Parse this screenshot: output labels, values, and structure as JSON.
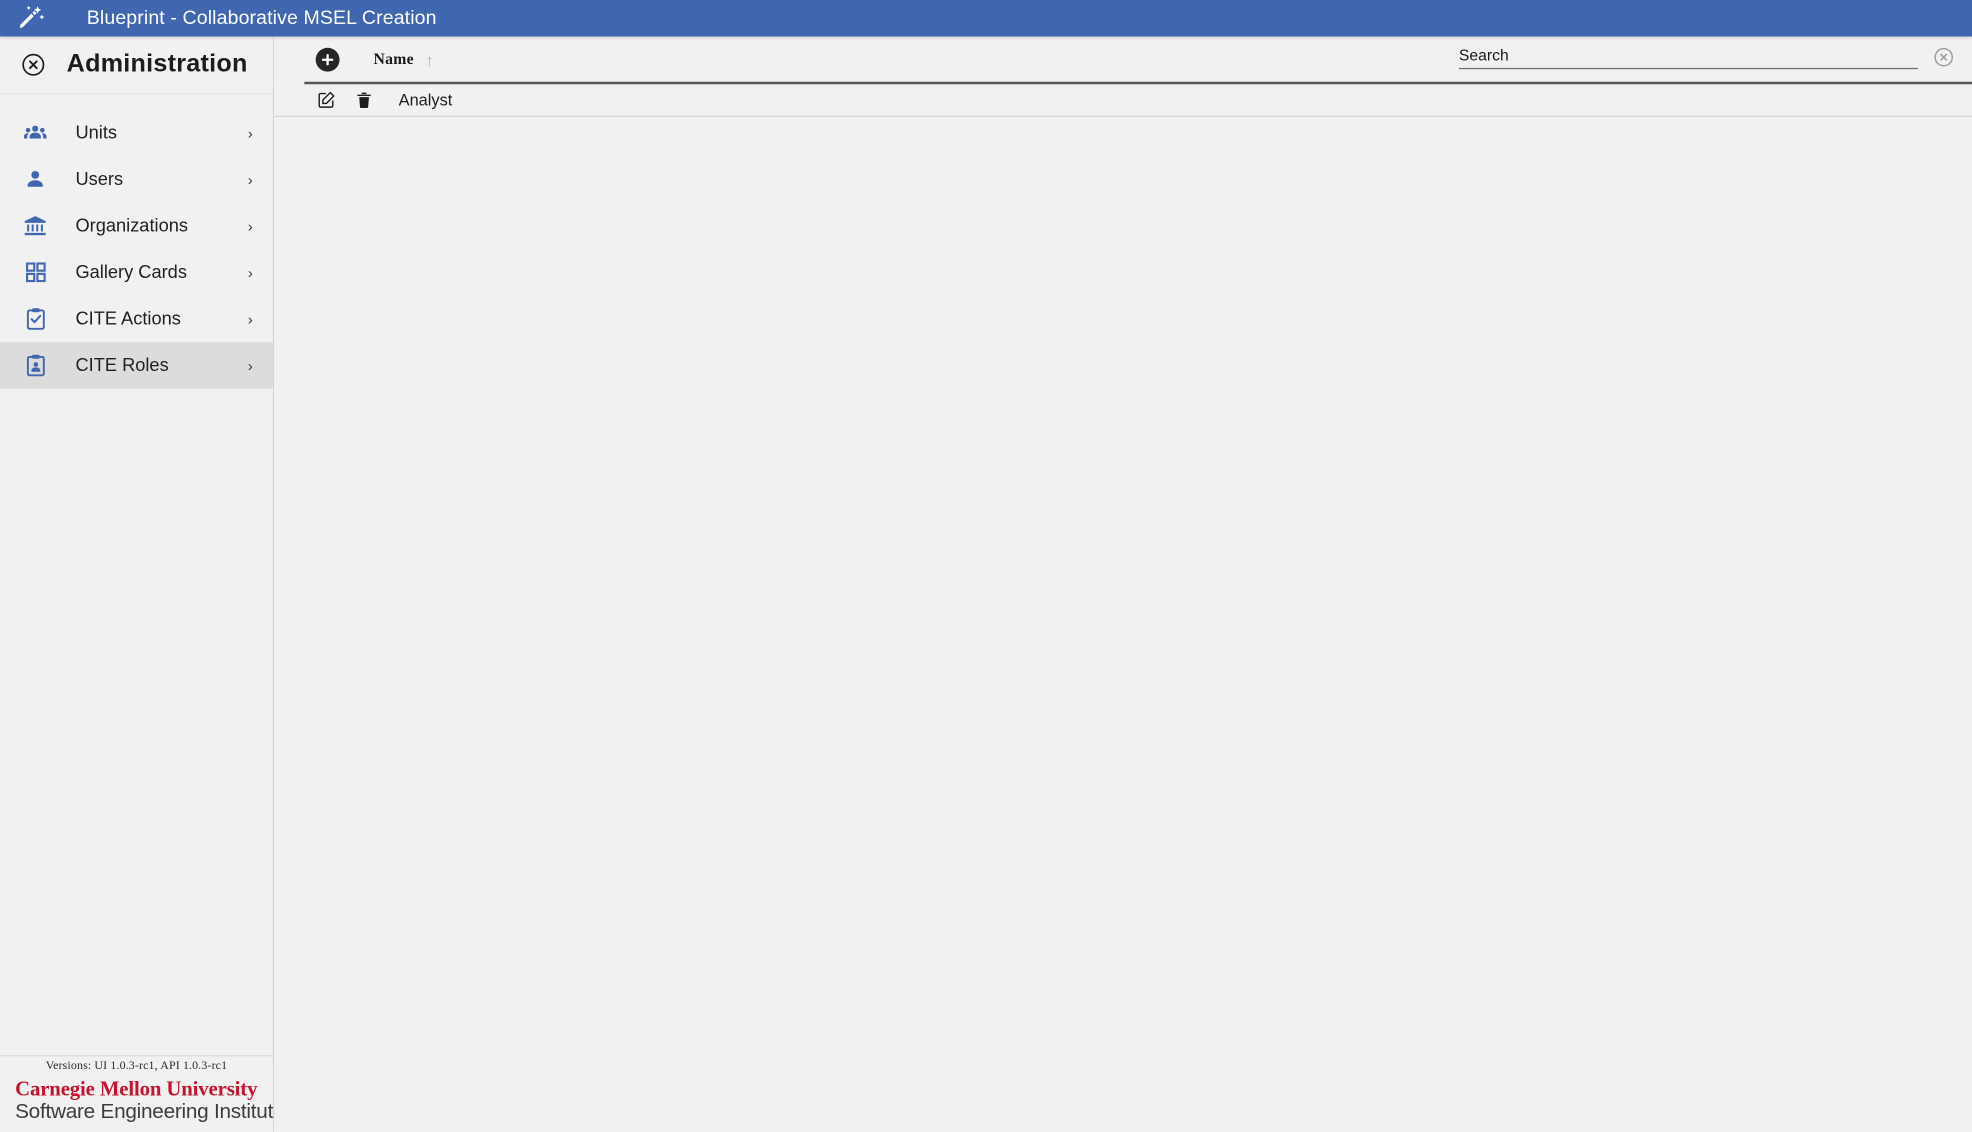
{
  "app": {
    "logo_icon": "magic-wand-icon",
    "title": "Blueprint - Collaborative MSEL Creation",
    "header_color": "#3f66ae",
    "accent_color": "#3f66ae"
  },
  "sidebar": {
    "close_icon": "close-circle-icon",
    "title": "Administration",
    "chevron": "›",
    "items": [
      {
        "label": "Units",
        "icon": "group-people-icon",
        "selected": false
      },
      {
        "label": "Users",
        "icon": "person-icon",
        "selected": false
      },
      {
        "label": "Organizations",
        "icon": "bank-building-icon",
        "selected": false
      },
      {
        "label": "Gallery Cards",
        "icon": "grid-squares-icon",
        "selected": false
      },
      {
        "label": "CITE Actions",
        "icon": "clipboard-check-icon",
        "selected": false
      },
      {
        "label": "CITE Roles",
        "icon": "clipboard-person-icon",
        "selected": true
      }
    ],
    "footer": {
      "versions": "Versions: UI 1.0.3-rc1, API 1.0.3-rc1",
      "logo_line1": "Carnegie Mellon University",
      "logo_line2": "Software Engineering Institute",
      "logo_line1_color": "#c41230",
      "logo_line2_color": "#3c3c3c"
    }
  },
  "main": {
    "toolbar": {
      "add_icon": "plus-circle-icon",
      "add_label": "",
      "column_header": "Name",
      "sort_direction": "ascending",
      "sort_arrow": "↑"
    },
    "search": {
      "placeholder": "Search",
      "value": "",
      "clear_icon": "clear-circle-icon"
    },
    "table": {
      "columns": [
        "Name"
      ],
      "rows": [
        {
          "name": "Analyst",
          "edit_icon": "edit-pencil-icon",
          "delete_icon": "trash-icon"
        }
      ]
    }
  }
}
